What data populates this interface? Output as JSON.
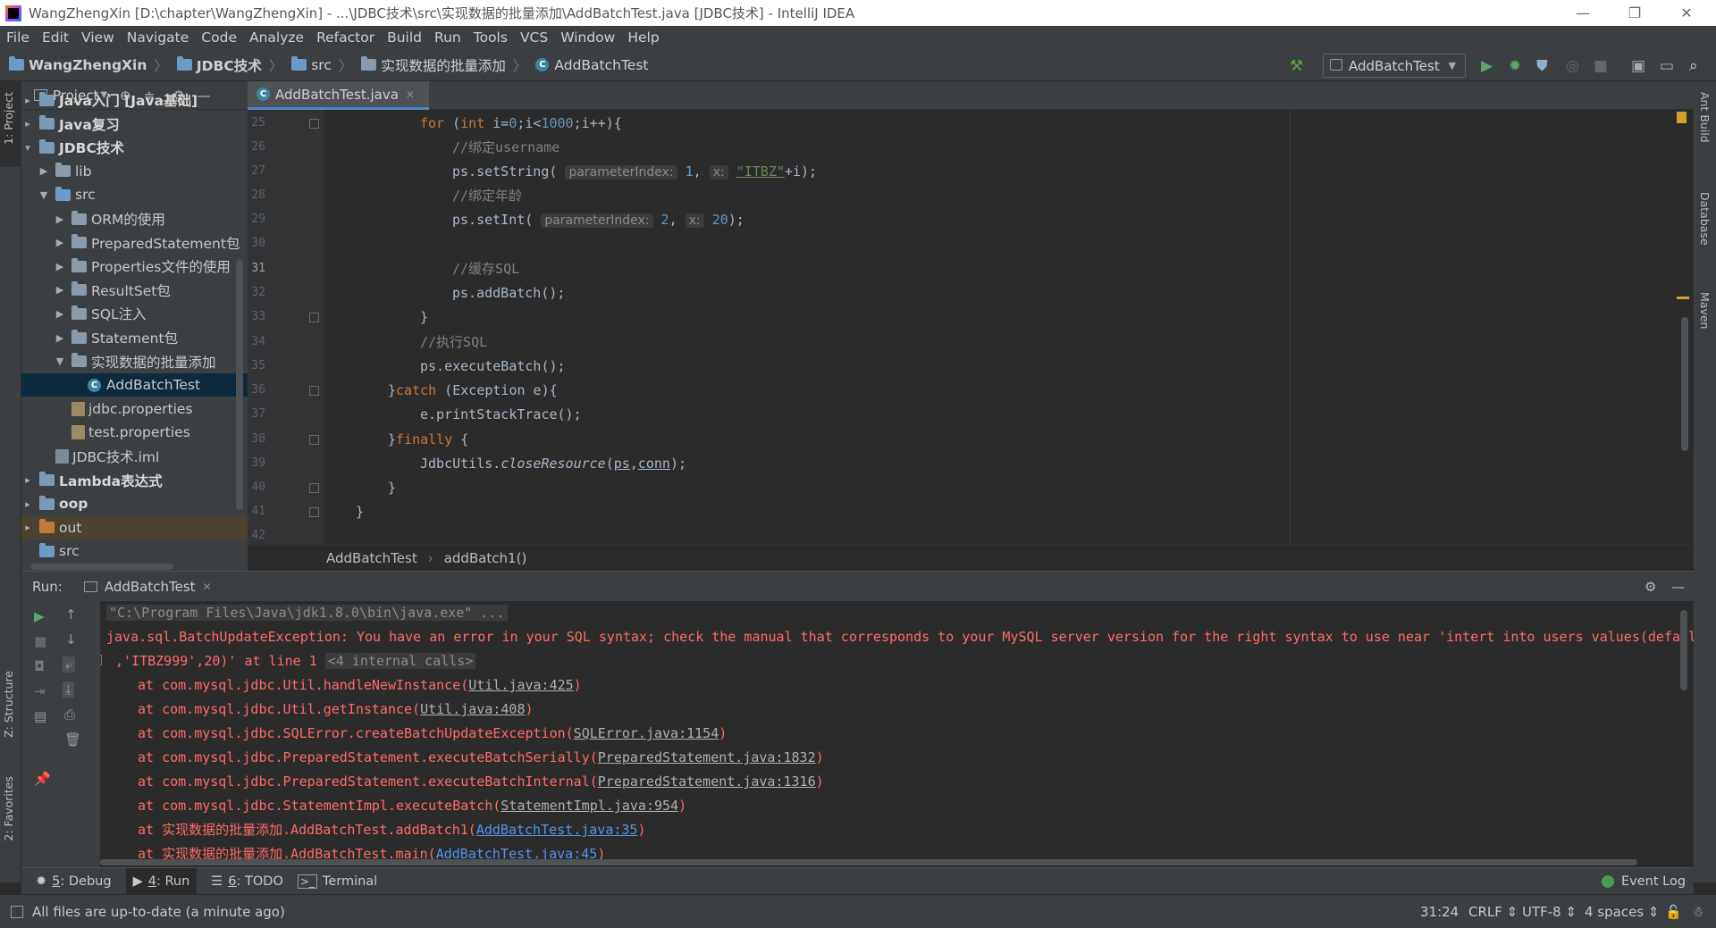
{
  "window": {
    "title": "WangZhengXin [D:\\chapter\\WangZhengXin] - ...\\JDBC技术\\src\\实现数据的批量添加\\AddBatchTest.java [JDBC技术] - IntelliJ IDEA",
    "minimize": "—",
    "restore": "❐",
    "close": "✕"
  },
  "menu": [
    "File",
    "Edit",
    "View",
    "Navigate",
    "Code",
    "Analyze",
    "Refactor",
    "Build",
    "Run",
    "Tools",
    "VCS",
    "Window",
    "Help"
  ],
  "breadcrumb": {
    "project": "WangZhengXin",
    "module": "JDBC技术",
    "src": "src",
    "package": "实现数据的批量添加",
    "class": "AddBatchTest"
  },
  "toolbar": {
    "run_config": "AddBatchTest",
    "icons": [
      "hammer-icon",
      "run-icon",
      "debug-icon",
      "coverage-icon",
      "profile-icon",
      "stop-icon",
      "project-structure-icon",
      "layout-icon",
      "search-icon"
    ]
  },
  "left_strip": {
    "project_tab": "1: Project",
    "structure_tab": "Z: Structure",
    "favorites_tab": "2: Favorites"
  },
  "right_strip": {
    "ant_build": "Ant Build",
    "database": "Database",
    "maven": "Maven"
  },
  "project_panel": {
    "header": "Project",
    "items": [
      {
        "label": "Java入门 [Java基础]",
        "depth": 0,
        "arrow": "▸",
        "bold": true,
        "icon": "module"
      },
      {
        "label": "Java复习",
        "depth": 0,
        "arrow": "▸",
        "bold": true,
        "icon": "module"
      },
      {
        "label": "JDBC技术",
        "depth": 0,
        "arrow": "▾",
        "bold": true,
        "icon": "module"
      },
      {
        "label": "lib",
        "depth": 1,
        "arrow": "▶",
        "bold": false,
        "icon": "folder"
      },
      {
        "label": "src",
        "depth": 1,
        "arrow": "▼",
        "bold": false,
        "icon": "src"
      },
      {
        "label": "ORM的使用",
        "depth": 2,
        "arrow": "▶",
        "bold": false,
        "icon": "package"
      },
      {
        "label": "PreparedStatement包",
        "depth": 2,
        "arrow": "▶",
        "bold": false,
        "icon": "package"
      },
      {
        "label": "Properties文件的使用",
        "depth": 2,
        "arrow": "▶",
        "bold": false,
        "icon": "package"
      },
      {
        "label": "ResultSet包",
        "depth": 2,
        "arrow": "▶",
        "bold": false,
        "icon": "package"
      },
      {
        "label": "SQL注入",
        "depth": 2,
        "arrow": "▶",
        "bold": false,
        "icon": "package"
      },
      {
        "label": "Statement包",
        "depth": 2,
        "arrow": "▶",
        "bold": false,
        "icon": "package"
      },
      {
        "label": "实现数据的批量添加",
        "depth": 2,
        "arrow": "▼",
        "bold": false,
        "icon": "package"
      },
      {
        "label": "AddBatchTest",
        "depth": 3,
        "arrow": "",
        "bold": false,
        "icon": "class",
        "selected": true
      },
      {
        "label": "jdbc.properties",
        "depth": 2,
        "arrow": "",
        "bold": false,
        "icon": "props"
      },
      {
        "label": "test.properties",
        "depth": 2,
        "arrow": "",
        "bold": false,
        "icon": "props"
      },
      {
        "label": "JDBC技术.iml",
        "depth": 1,
        "arrow": "",
        "bold": false,
        "icon": "iml"
      },
      {
        "label": "Lambda表达式",
        "depth": 0,
        "arrow": "▸",
        "bold": true,
        "icon": "module"
      },
      {
        "label": "oop",
        "depth": 0,
        "arrow": "▸",
        "bold": true,
        "icon": "module"
      },
      {
        "label": "out",
        "depth": 0,
        "arrow": "▸",
        "bold": false,
        "icon": "out",
        "highlight": true
      },
      {
        "label": "src",
        "depth": 0,
        "arrow": "",
        "bold": false,
        "icon": "src"
      }
    ]
  },
  "editor": {
    "tab": "AddBatchTest.java",
    "line_numbers": [
      "25",
      "26",
      "27",
      "28",
      "29",
      "30",
      "31",
      "32",
      "33",
      "34",
      "35",
      "36",
      "37",
      "38",
      "39",
      "40",
      "41",
      "42"
    ],
    "code": {
      "l25_kw": "for",
      "l25_a": " (",
      "l25_int": "int",
      "l25_b": " i=",
      "l25_0": "0",
      "l25_c": ";i<",
      "l25_1000": "1000",
      "l25_d": ";i++){",
      "l26": "//绑定username",
      "l27_a": "ps.setString(",
      "l27_h1": "parameterIndex:",
      "l27_n1": "1",
      "l27_b": ",",
      "l27_h2": "x:",
      "l27_s": "\"ITBZ\"",
      "l27_c": "+i);",
      "l28": "//绑定年龄",
      "l29_a": "ps.setInt(",
      "l29_h1": "parameterIndex:",
      "l29_n1": "2",
      "l29_b": ",",
      "l29_h2": "x:",
      "l29_n2": "20",
      "l29_c": ");",
      "l31": "//缓存SQL",
      "l32": "ps.addBatch();",
      "l33": "}",
      "l34": "//执行SQL",
      "l35": "ps.executeBatch();",
      "l36_a": "}",
      "l36_kw": "catch",
      "l36_b": " (Exception e){",
      "l37": "e.printStackTrace();",
      "l38_a": "}",
      "l38_kw": "finally",
      "l38_b": " {",
      "l39_a": "JdbcUtils.",
      "l39_m": "closeResource",
      "l39_b": "(",
      "l39_ps": "ps",
      "l39_c": ",",
      "l39_conn": "conn",
      "l39_d": ");",
      "l40": "}",
      "l41": "}"
    },
    "breadcrumb": {
      "class": "AddBatchTest",
      "method": "addBatch1()"
    }
  },
  "run_panel": {
    "label": "Run:",
    "tab": "AddBatchTest",
    "console": {
      "cmd": "\"C:\\Program Files\\Java\\jdk1.8.0\\bin\\java.exe\" ...",
      "err1": "java.sql.BatchUpdateException: You have an error in your SQL syntax; check the manual that corresponds to your MySQL server version for the right syntax to use near 'intert into users values(defaul",
      "err2": ",'ITBZ999',20)' at line 1",
      "internal": "<4 internal calls>",
      "stack": [
        {
          "at": "at com.mysql.jdbc.Util.handleNewInstance(",
          "src": "Util.java:425",
          "end": ")",
          "blue": false
        },
        {
          "at": "at com.mysql.jdbc.Util.getInstance(",
          "src": "Util.java:408",
          "end": ")",
          "blue": false
        },
        {
          "at": "at com.mysql.jdbc.SQLError.createBatchUpdateException(",
          "src": "SQLError.java:1154",
          "end": ")",
          "blue": false
        },
        {
          "at": "at com.mysql.jdbc.PreparedStatement.executeBatchSerially(",
          "src": "PreparedStatement.java:1832",
          "end": ")",
          "blue": false
        },
        {
          "at": "at com.mysql.jdbc.PreparedStatement.executeBatchInternal(",
          "src": "PreparedStatement.java:1316",
          "end": ")",
          "blue": false
        },
        {
          "at": "at com.mysql.jdbc.StatementImpl.executeBatch(",
          "src": "StatementImpl.java:954",
          "end": ")",
          "blue": false
        },
        {
          "at": "at 实现数据的批量添加.AddBatchTest.addBatch1(",
          "src": "AddBatchTest.java:35",
          "end": ")",
          "blue": true
        },
        {
          "at": "at 实现数据的批量添加.AddBatchTest.main(",
          "src": "AddBatchTest.java:45",
          "end": ")",
          "blue": true
        }
      ]
    }
  },
  "bottom_tabs": [
    {
      "num": "5",
      "label": ": Debug",
      "icon": "bug-icon"
    },
    {
      "num": "4",
      "label": ": Run",
      "icon": "run-tab-icon"
    },
    {
      "num": "6",
      "label": ": TODO",
      "icon": "todo-icon"
    },
    {
      "num": "",
      "label": "Terminal",
      "icon": "terminal-icon"
    }
  ],
  "event_log": "Event Log",
  "status": {
    "message": "All files are up-to-date (a minute ago)",
    "position": "31:24",
    "line_sep": "CRLF",
    "encoding": "UTF-8",
    "indent": "4 spaces"
  },
  "colors": {
    "selection": "#0d293e",
    "error": "#ff6b68",
    "keyword": "#cc7832",
    "number": "#6897bb",
    "string": "#6a8759",
    "comment": "#808080"
  }
}
